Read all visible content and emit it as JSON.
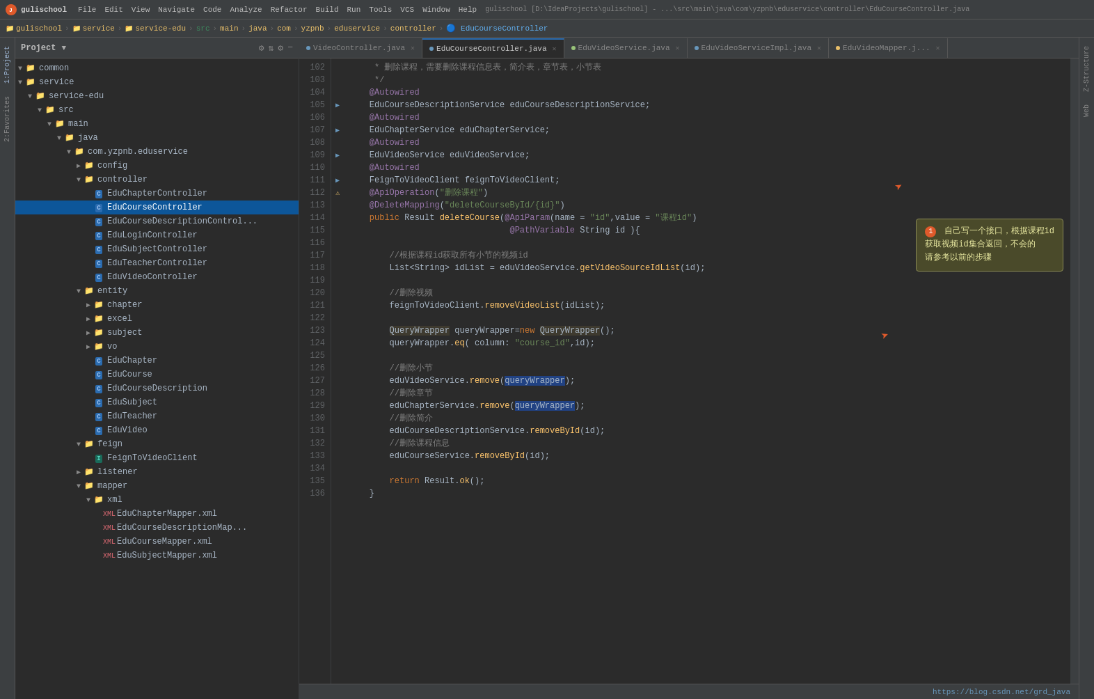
{
  "titleBar": {
    "appName": "gulischool",
    "pathText": "gulischool [D:\\IdeaProjects\\gulischool] - ...\\src\\main\\java\\com\\yzpnb\\eduservice\\controller\\EduCourseController.java",
    "menus": [
      "File",
      "Edit",
      "View",
      "Navigate",
      "Code",
      "Analyze",
      "Refactor",
      "Build",
      "Run",
      "Tools",
      "VCS",
      "Window",
      "Help"
    ]
  },
  "breadcrumb": {
    "items": [
      "gulischool",
      "service",
      "service-edu",
      "src",
      "main",
      "java",
      "com",
      "yzpnb",
      "eduservice",
      "controller",
      "EduCourseController"
    ]
  },
  "projectPanel": {
    "title": "Project",
    "tree": [
      {
        "indent": 1,
        "arrow": "▼",
        "icon": "folder",
        "label": "common"
      },
      {
        "indent": 1,
        "arrow": "▼",
        "icon": "folder",
        "label": "service"
      },
      {
        "indent": 2,
        "arrow": "▼",
        "icon": "folder",
        "label": "service-edu"
      },
      {
        "indent": 3,
        "arrow": "▼",
        "icon": "folder-src",
        "label": "src"
      },
      {
        "indent": 4,
        "arrow": "▼",
        "icon": "folder",
        "label": "main"
      },
      {
        "indent": 5,
        "arrow": "▼",
        "icon": "folder",
        "label": "java"
      },
      {
        "indent": 6,
        "arrow": "▼",
        "icon": "folder-pkg",
        "label": "com.yzpnb.eduservice"
      },
      {
        "indent": 7,
        "arrow": "▶",
        "icon": "folder",
        "label": "config"
      },
      {
        "indent": 7,
        "arrow": "▼",
        "icon": "folder",
        "label": "controller"
      },
      {
        "indent": 8,
        "arrow": "",
        "icon": "class-c",
        "label": "EduChapterController"
      },
      {
        "indent": 8,
        "arrow": "",
        "icon": "class-c",
        "label": "EduCourseController",
        "selected": true
      },
      {
        "indent": 8,
        "arrow": "",
        "icon": "class-c",
        "label": "EduCourseDescriptionControl..."
      },
      {
        "indent": 8,
        "arrow": "",
        "icon": "class-c",
        "label": "EduLoginController"
      },
      {
        "indent": 8,
        "arrow": "",
        "icon": "class-c",
        "label": "EduSubjectController"
      },
      {
        "indent": 8,
        "arrow": "",
        "icon": "class-c",
        "label": "EduTeacherController"
      },
      {
        "indent": 8,
        "arrow": "",
        "icon": "class-c",
        "label": "EduVideoController"
      },
      {
        "indent": 7,
        "arrow": "▼",
        "icon": "folder",
        "label": "entity"
      },
      {
        "indent": 8,
        "arrow": "▶",
        "icon": "folder",
        "label": "chapter"
      },
      {
        "indent": 8,
        "arrow": "▶",
        "icon": "folder",
        "label": "excel"
      },
      {
        "indent": 8,
        "arrow": "▶",
        "icon": "folder",
        "label": "subject"
      },
      {
        "indent": 8,
        "arrow": "▶",
        "icon": "folder",
        "label": "vo"
      },
      {
        "indent": 8,
        "arrow": "",
        "icon": "class-c",
        "label": "EduChapter"
      },
      {
        "indent": 8,
        "arrow": "",
        "icon": "class-c",
        "label": "EduCourse"
      },
      {
        "indent": 8,
        "arrow": "",
        "icon": "class-c",
        "label": "EduCourseDescription"
      },
      {
        "indent": 8,
        "arrow": "",
        "icon": "class-c",
        "label": "EduSubject"
      },
      {
        "indent": 8,
        "arrow": "",
        "icon": "class-c",
        "label": "EduTeacher"
      },
      {
        "indent": 8,
        "arrow": "",
        "icon": "class-c",
        "label": "EduVideo"
      },
      {
        "indent": 7,
        "arrow": "▼",
        "icon": "folder",
        "label": "feign"
      },
      {
        "indent": 8,
        "arrow": "",
        "icon": "class-i",
        "label": "FeignToVideoClient"
      },
      {
        "indent": 7,
        "arrow": "▶",
        "icon": "folder",
        "label": "listener"
      },
      {
        "indent": 7,
        "arrow": "▼",
        "icon": "folder",
        "label": "mapper"
      },
      {
        "indent": 8,
        "arrow": "▼",
        "icon": "folder",
        "label": "xml"
      },
      {
        "indent": 9,
        "arrow": "",
        "icon": "xml",
        "label": "EduChapterMapper.xml"
      },
      {
        "indent": 9,
        "arrow": "",
        "icon": "xml",
        "label": "EduCourseDescriptionMap..."
      },
      {
        "indent": 9,
        "arrow": "",
        "icon": "xml",
        "label": "EduCourseMapper.xml"
      },
      {
        "indent": 9,
        "arrow": "",
        "icon": "xml",
        "label": "EduSubjectMapper.xml"
      }
    ]
  },
  "tabs": [
    {
      "label": "VideoController.java",
      "type": "java",
      "active": false,
      "closable": true
    },
    {
      "label": "EduCourseController.java",
      "type": "java",
      "active": true,
      "closable": true
    },
    {
      "label": "EduVideoService.java",
      "type": "java-i",
      "active": false,
      "closable": true
    },
    {
      "label": "EduVideoServiceImpl.java",
      "type": "java",
      "active": false,
      "closable": true
    },
    {
      "label": "EduVideoMapper.j...",
      "type": "java-i",
      "active": false,
      "closable": true
    }
  ],
  "codeLines": [
    {
      "num": 102,
      "gutter": "",
      "text": "     * 删除课程，需要删除课程信息表，简介表，章节表，小节表"
    },
    {
      "num": 103,
      "gutter": "",
      "text": "     */"
    },
    {
      "num": 104,
      "gutter": "",
      "text": "    @Autowired"
    },
    {
      "num": 105,
      "gutter": "arrow",
      "text": "    EduCourseDescriptionService eduCourseDescriptionService;"
    },
    {
      "num": 106,
      "gutter": "",
      "text": "    @Autowired"
    },
    {
      "num": 107,
      "gutter": "arrow",
      "text": "    EduChapterService eduChapterService;"
    },
    {
      "num": 108,
      "gutter": "",
      "text": "    @Autowired"
    },
    {
      "num": 109,
      "gutter": "arrow",
      "text": "    EduVideoService eduVideoService;"
    },
    {
      "num": 110,
      "gutter": "",
      "text": "    @Autowired"
    },
    {
      "num": 111,
      "gutter": "arrow",
      "text": "    FeignToVideoClient feignToVideoClient;"
    },
    {
      "num": 112,
      "gutter": "warn",
      "text": "    @ApiOperation(\"删除课程\")"
    },
    {
      "num": 113,
      "gutter": "",
      "text": "    @DeleteMapping(\"deleteCourseById/{id}\")"
    },
    {
      "num": 114,
      "gutter": "",
      "text": "    public Result deleteCourse(@ApiParam(name = \"id\",value = \"课程id\")"
    },
    {
      "num": 115,
      "gutter": "",
      "text": "                                @PathVariable String id ){"
    },
    {
      "num": 116,
      "gutter": "",
      "text": ""
    },
    {
      "num": 117,
      "gutter": "",
      "text": "        //根据课程id获取所有小节的视频id"
    },
    {
      "num": 118,
      "gutter": "",
      "text": "        List<String> idList = eduVideoService.getVideoSourceIdList(id);"
    },
    {
      "num": 119,
      "gutter": "",
      "text": ""
    },
    {
      "num": 120,
      "gutter": "",
      "text": "        //删除视频"
    },
    {
      "num": 121,
      "gutter": "",
      "text": "        feignToVideoClient.removeVideoList(idList);"
    },
    {
      "num": 122,
      "gutter": "",
      "text": ""
    },
    {
      "num": 123,
      "gutter": "",
      "text": "        QueryWrapper queryWrapper=new QueryWrapper();"
    },
    {
      "num": 124,
      "gutter": "",
      "text": "        queryWrapper.eq( column: \"course_id\",id);"
    },
    {
      "num": 125,
      "gutter": "",
      "text": ""
    },
    {
      "num": 126,
      "gutter": "",
      "text": "        //删除小节"
    },
    {
      "num": 127,
      "gutter": "",
      "text": "        eduVideoService.remove(queryWrapper);"
    },
    {
      "num": 128,
      "gutter": "",
      "text": "        //删除章节"
    },
    {
      "num": 129,
      "gutter": "",
      "text": "        eduChapterService.remove(queryWrapper);"
    },
    {
      "num": 130,
      "gutter": "",
      "text": "        //删除简介"
    },
    {
      "num": 131,
      "gutter": "",
      "text": "        eduCourseDescriptionService.removeById(id);"
    },
    {
      "num": 132,
      "gutter": "",
      "text": "        //删除课程信息"
    },
    {
      "num": 133,
      "gutter": "",
      "text": "        eduCourseService.removeById(id);"
    },
    {
      "num": 134,
      "gutter": "",
      "text": ""
    },
    {
      "num": 135,
      "gutter": "",
      "text": "        return Result.ok();"
    },
    {
      "num": 136,
      "gutter": "",
      "text": "    }"
    }
  ],
  "annotation": {
    "number": "1",
    "text": "自己写一个接口，根据课程id\n获取视频id集合返回，不会的\n请参考以前的步骤"
  },
  "statusBar": {
    "url": "https://blog.csdn.net/grd_java"
  },
  "sideTabs": {
    "left": [
      "1:Project",
      "2:Favorites"
    ],
    "right": [
      "Z-Structure",
      "Web"
    ]
  }
}
